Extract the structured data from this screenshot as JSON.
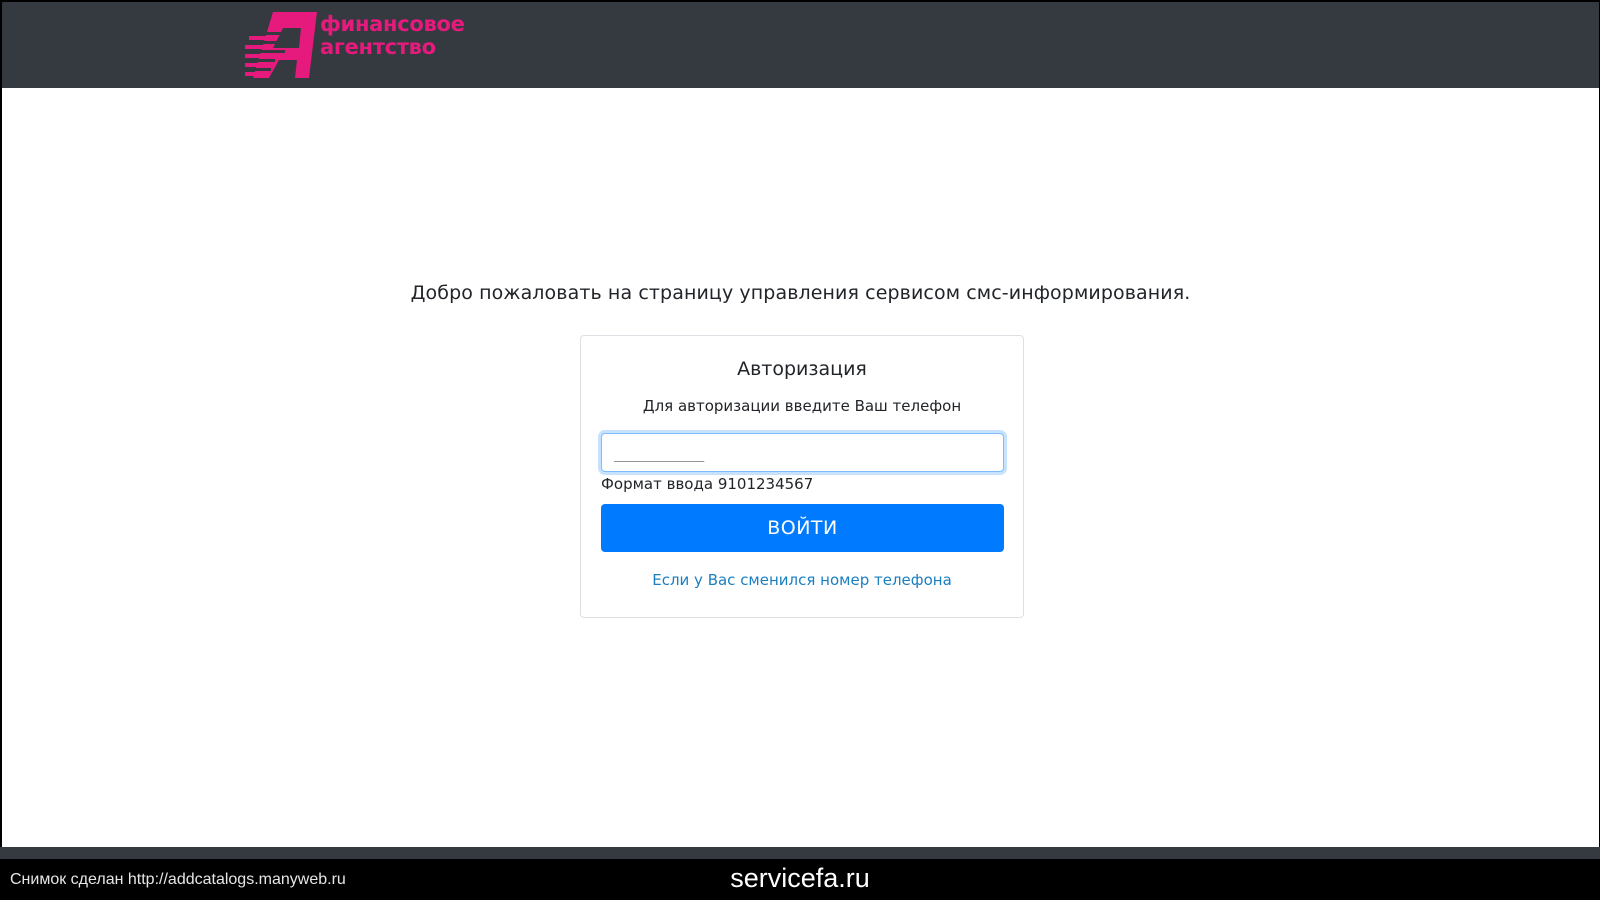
{
  "header": {
    "logo_line1": "финансовое",
    "logo_line2": "агентство",
    "logo_icon": "fa-logo-icon",
    "logo_color": "#e6197d",
    "background_color": "#343a40"
  },
  "main": {
    "welcome_text": "Добро пожаловать на страницу управления сервисом смс-информирования."
  },
  "auth_card": {
    "title": "Авторизация",
    "subtitle": "Для авторизации введите Ваш телефон",
    "phone_input": {
      "value": "",
      "placeholder": "__________"
    },
    "format_hint": "Формат ввода 9101234567",
    "login_label": "ВОЙТИ",
    "login_color": "#007bff",
    "change_phone_link": "Если у Вас сменился номер телефона"
  },
  "caption": {
    "left_text": "Снимок сделан http://addcatalogs.manyweb.ru",
    "center_text": "servicefa.ru"
  }
}
